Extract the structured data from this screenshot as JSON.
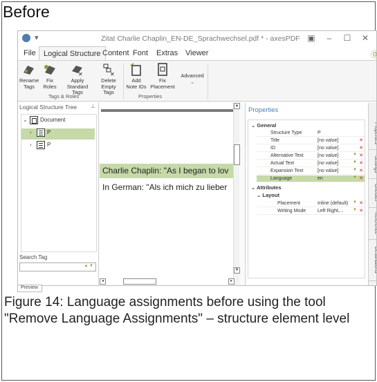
{
  "before_label": "Before",
  "titlebar": {
    "quick_access": "▾",
    "title": "Zitat Charlie Chaplin_EN-DE_Sprachwechsel.pdf * - axesPDF",
    "restore_icon": "restore-icon",
    "min": "–",
    "max": "☐",
    "close": "✕"
  },
  "menu": {
    "tabs": [
      "File",
      "Logical Structure",
      "Content",
      "Font",
      "Extras",
      "Viewer"
    ],
    "active": "Logical Structure"
  },
  "ribbon": {
    "buttons": [
      {
        "label": "Rename Tags",
        "icon": "rename-tags-icon"
      },
      {
        "label": "Fix Roles",
        "icon": "fix-roles-icon"
      },
      {
        "label": "Apply Standard Tags",
        "icon": "apply-standard-tags-icon"
      },
      {
        "label": "Delete Empty Tags",
        "icon": "delete-empty-tags-icon"
      },
      {
        "label": "Add Note IDs",
        "icon": "add-note-ids-icon"
      },
      {
        "label": "Fix Placement",
        "icon": "fix-placement-icon"
      },
      {
        "label": "Advanced",
        "icon": "advanced-icon"
      }
    ],
    "groups": [
      "Tags & Roles",
      "Properties"
    ]
  },
  "left_panel": {
    "title": "Logical Structure Tree",
    "pin": "ᵾ",
    "tree": [
      {
        "label": "Document",
        "type": "doc"
      },
      {
        "label": "P",
        "type": "p"
      },
      {
        "label": "P",
        "type": "p"
      }
    ],
    "search_label": "Search Tag",
    "search_value": ""
  },
  "center": {
    "lines": [
      "Charlie Chaplin: \"As I began to lov",
      "In German: \"Als ich mich zu lieber"
    ]
  },
  "properties": {
    "title": "Properties",
    "pin": "ᵾ",
    "general_label": "General",
    "rows": [
      {
        "name": "Structure Type",
        "value": "P",
        "dd": false,
        "x": false
      },
      {
        "name": "Title",
        "value": "[no value]",
        "dd": false,
        "x": true
      },
      {
        "name": "ID",
        "value": "[no value]",
        "dd": false,
        "x": true
      },
      {
        "name": "Alternative Text",
        "value": "[no value]",
        "dd": true,
        "x": true
      },
      {
        "name": "Actual Text",
        "value": "[no value]",
        "dd": true,
        "x": true
      },
      {
        "name": "Expansion Text",
        "value": "[no value]",
        "dd": true,
        "x": true
      },
      {
        "name": "Language",
        "value": "en",
        "dd": true,
        "x": true
      }
    ],
    "attributes_label": "Attributes",
    "layout_label": "Layout",
    "layout_rows": [
      {
        "name": "Placement",
        "value": "Inline (default)",
        "dd": true,
        "x": true
      },
      {
        "name": "Writing Mode",
        "value": "Left Right,...",
        "dd": true,
        "x": true
      }
    ],
    "side_tabs": [
      "Properties",
      "Settings",
      "Checker",
      "Reference",
      "Destinations"
    ]
  },
  "preview_tab": "Preview",
  "caption": "Figure 14: Language assignments before using the tool \"Remove Language Assignments\" – structure element level"
}
